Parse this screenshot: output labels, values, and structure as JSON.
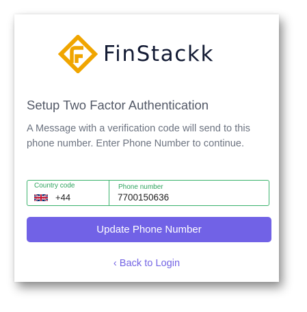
{
  "brand": {
    "name": "FinStackk",
    "logo_icon": "finstackk-logo-icon",
    "accent_color": "#f0a500"
  },
  "heading": "Setup Two Factor Authentication",
  "description": "A Message with a verification code will send to this phone number. Enter Phone Number to continue.",
  "phone_form": {
    "country_label": "Country code",
    "country_flag": "uk-flag-icon",
    "country_code": "+44",
    "phone_label": "Phone number",
    "phone_value": "7700150636",
    "border_color": "#38b16a"
  },
  "update_button": {
    "label": "Update Phone Number",
    "color": "#7162e6"
  },
  "back_link": {
    "chevron_icon": "chevron-left-icon",
    "label": "Back to Login"
  }
}
